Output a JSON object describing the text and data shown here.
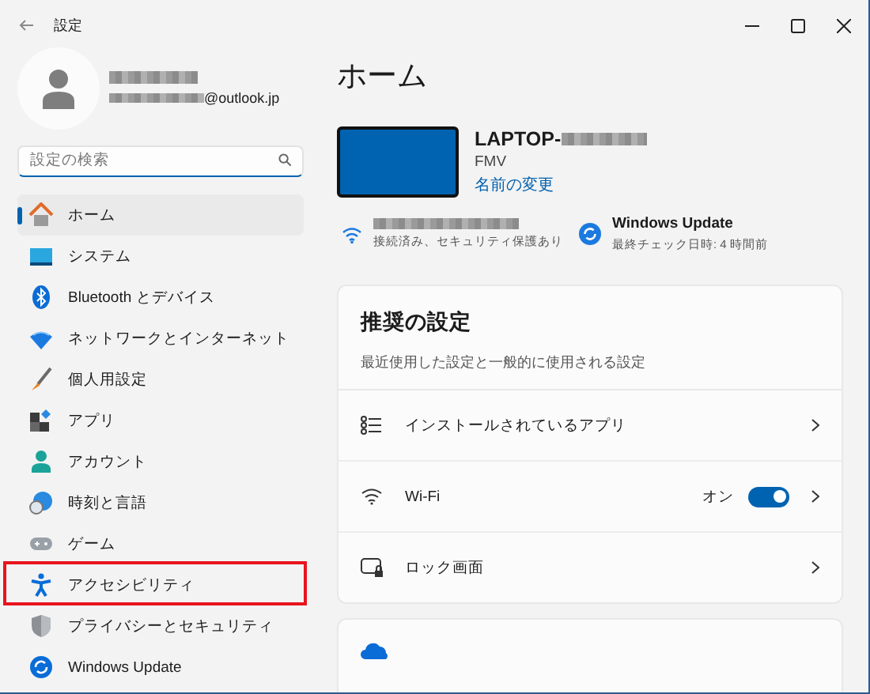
{
  "window": {
    "title": "設定"
  },
  "account": {
    "email_suffix": "@outlook.jp"
  },
  "search": {
    "placeholder": "設定の検索"
  },
  "nav": {
    "items": [
      {
        "label": "ホーム",
        "selected": true,
        "highlighted": false
      },
      {
        "label": "システム",
        "selected": false,
        "highlighted": false
      },
      {
        "label": "Bluetooth とデバイス",
        "selected": false,
        "highlighted": false
      },
      {
        "label": "ネットワークとインターネット",
        "selected": false,
        "highlighted": false
      },
      {
        "label": "個人用設定",
        "selected": false,
        "highlighted": false
      },
      {
        "label": "アプリ",
        "selected": false,
        "highlighted": false
      },
      {
        "label": "アカウント",
        "selected": false,
        "highlighted": false
      },
      {
        "label": "時刻と言語",
        "selected": false,
        "highlighted": false
      },
      {
        "label": "ゲーム",
        "selected": false,
        "highlighted": false
      },
      {
        "label": "アクセシビリティ",
        "selected": false,
        "highlighted": true
      },
      {
        "label": "プライバシーとセキュリティ",
        "selected": false,
        "highlighted": false
      },
      {
        "label": "Windows Update",
        "selected": false,
        "highlighted": false
      }
    ]
  },
  "page": {
    "title": "ホーム",
    "device": {
      "name": "LAPTOP-",
      "model": "FMV",
      "rename_link": "名前の変更"
    },
    "status": [
      {
        "kind": "network",
        "subtitle": "接続済み、セキュリティ保護あり"
      },
      {
        "kind": "update",
        "title": "Windows Update",
        "subtitle": "最終チェック日時: 4 時間前"
      }
    ],
    "recommended": {
      "title": "推奨の設定",
      "subtitle": "最近使用した設定と一般的に使用される設定",
      "rows": [
        {
          "kind": "link",
          "label": "インストールされているアプリ"
        },
        {
          "kind": "toggle",
          "label": "Wi-Fi",
          "state_text": "オン",
          "on": true
        },
        {
          "kind": "link",
          "label": "ロック画面"
        }
      ]
    }
  }
}
